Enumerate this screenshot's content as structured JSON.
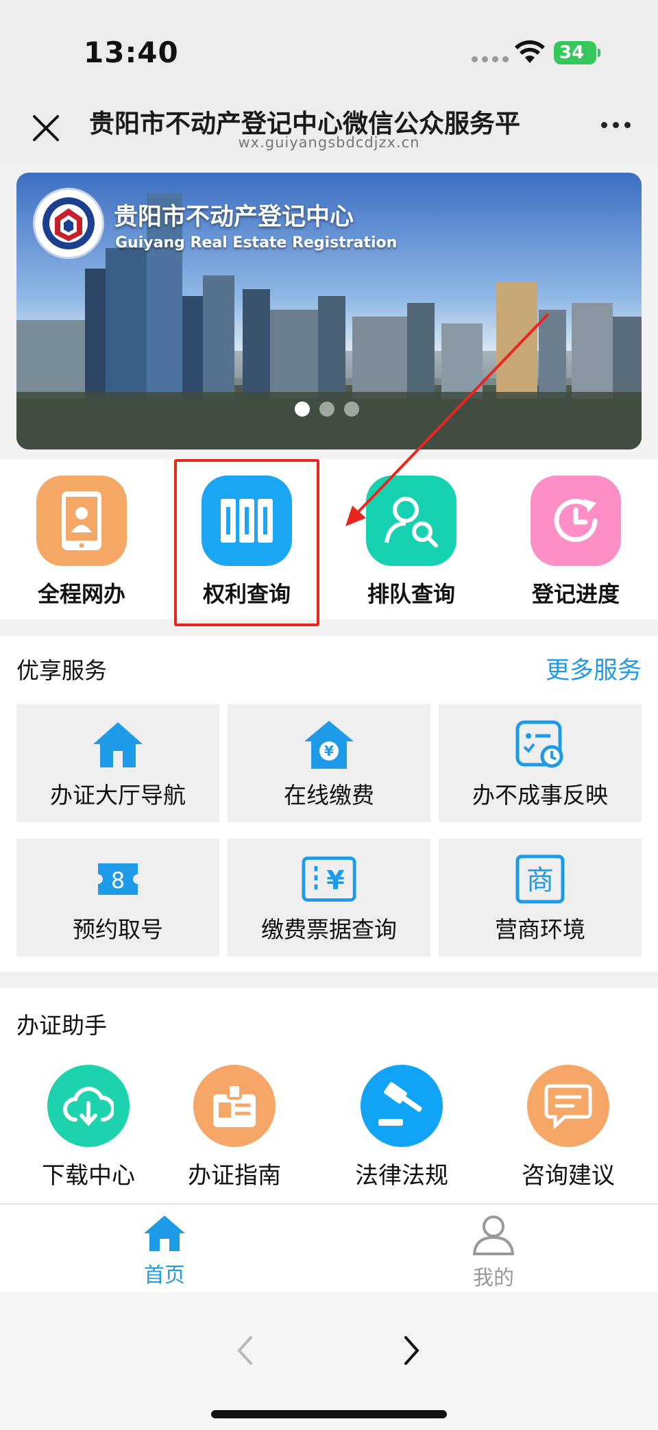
{
  "status_bar": {
    "time": "13:40",
    "battery": "34"
  },
  "nav": {
    "title": "贵阳市不动产登记中心微信公众服务平",
    "url": "wx.guiyangsbdcdjzx.cn"
  },
  "banner": {
    "title": "贵阳市不动产登记中心",
    "subtitle": "Guiyang Real Estate Registration",
    "slide_count": 3,
    "active_slide": 1
  },
  "quick_menu": [
    {
      "label": "全程网办",
      "icon": "phone-user-icon",
      "color": "#f5a866"
    },
    {
      "label": "权利查询",
      "icon": "books-icon",
      "color": "#1aa6f2"
    },
    {
      "label": "排队查询",
      "icon": "user-search-icon",
      "color": "#17d2b0"
    },
    {
      "label": "登记进度",
      "icon": "clock-refresh-icon",
      "color": "#fd8fc6"
    }
  ],
  "services": {
    "title": "优享服务",
    "more": "更多服务",
    "items": [
      {
        "label": "办证大厅导航",
        "icon": "home-icon"
      },
      {
        "label": "在线缴费",
        "icon": "house-yen-icon"
      },
      {
        "label": "办不成事反映",
        "icon": "feedback-card-icon"
      },
      {
        "label": "预约取号",
        "icon": "ticket-icon"
      },
      {
        "label": "缴费票据查询",
        "icon": "yen-receipt-icon"
      },
      {
        "label": "营商环境",
        "icon": "shang-icon"
      }
    ]
  },
  "assistant": {
    "title": "办证助手",
    "items": [
      {
        "label": "下载中心",
        "icon": "cloud-download-icon",
        "color": "#1cd3ad"
      },
      {
        "label": "办证指南",
        "icon": "guide-id-icon",
        "color": "#f6a767"
      },
      {
        "label": "法律法规",
        "icon": "gavel-icon",
        "color": "#11a3f5"
      },
      {
        "label": "咨询建议",
        "icon": "chat-icon",
        "color": "#f6a767"
      }
    ]
  },
  "tabbar": {
    "home": "首页",
    "mine": "我的"
  },
  "colors": {
    "accent": "#1e9be8",
    "highlight": "#e8261f"
  }
}
